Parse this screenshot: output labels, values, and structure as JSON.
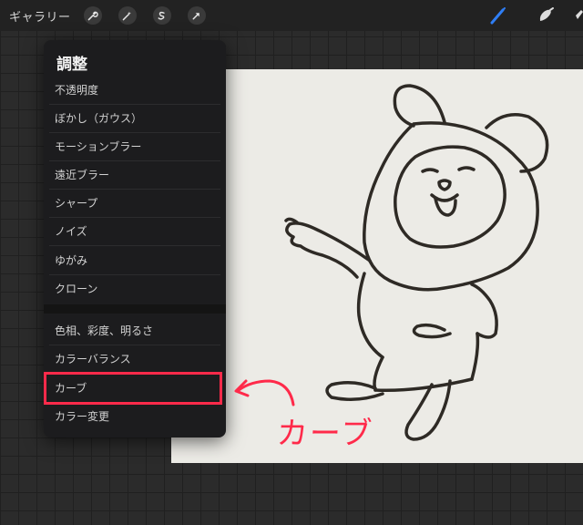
{
  "toolbar": {
    "gallery_label": "ギャラリー",
    "left_icons": [
      "wrench-icon",
      "magic-wand-icon",
      "selection-s-icon",
      "arrow-transform-icon"
    ],
    "right_icons": [
      "brush-icon",
      "smudge-icon",
      "eraser-icon"
    ],
    "brush_color": "#2f7ef5"
  },
  "panel": {
    "title": "調整",
    "items": [
      {
        "label": "不透明度"
      },
      {
        "label": "ぼかし（ガウス）"
      },
      {
        "label": "モーションブラー"
      },
      {
        "label": "遠近ブラー"
      },
      {
        "label": "シャープ"
      },
      {
        "label": "ノイズ"
      },
      {
        "label": "ゆがみ"
      },
      {
        "label": "クローン"
      },
      {
        "label": "色相、彩度、明るさ"
      },
      {
        "label": "カラーバランス"
      },
      {
        "label": "カーブ"
      },
      {
        "label": "カラー変更"
      }
    ]
  },
  "annotation": {
    "text": "カーブ",
    "color": "#ff2a4a"
  }
}
